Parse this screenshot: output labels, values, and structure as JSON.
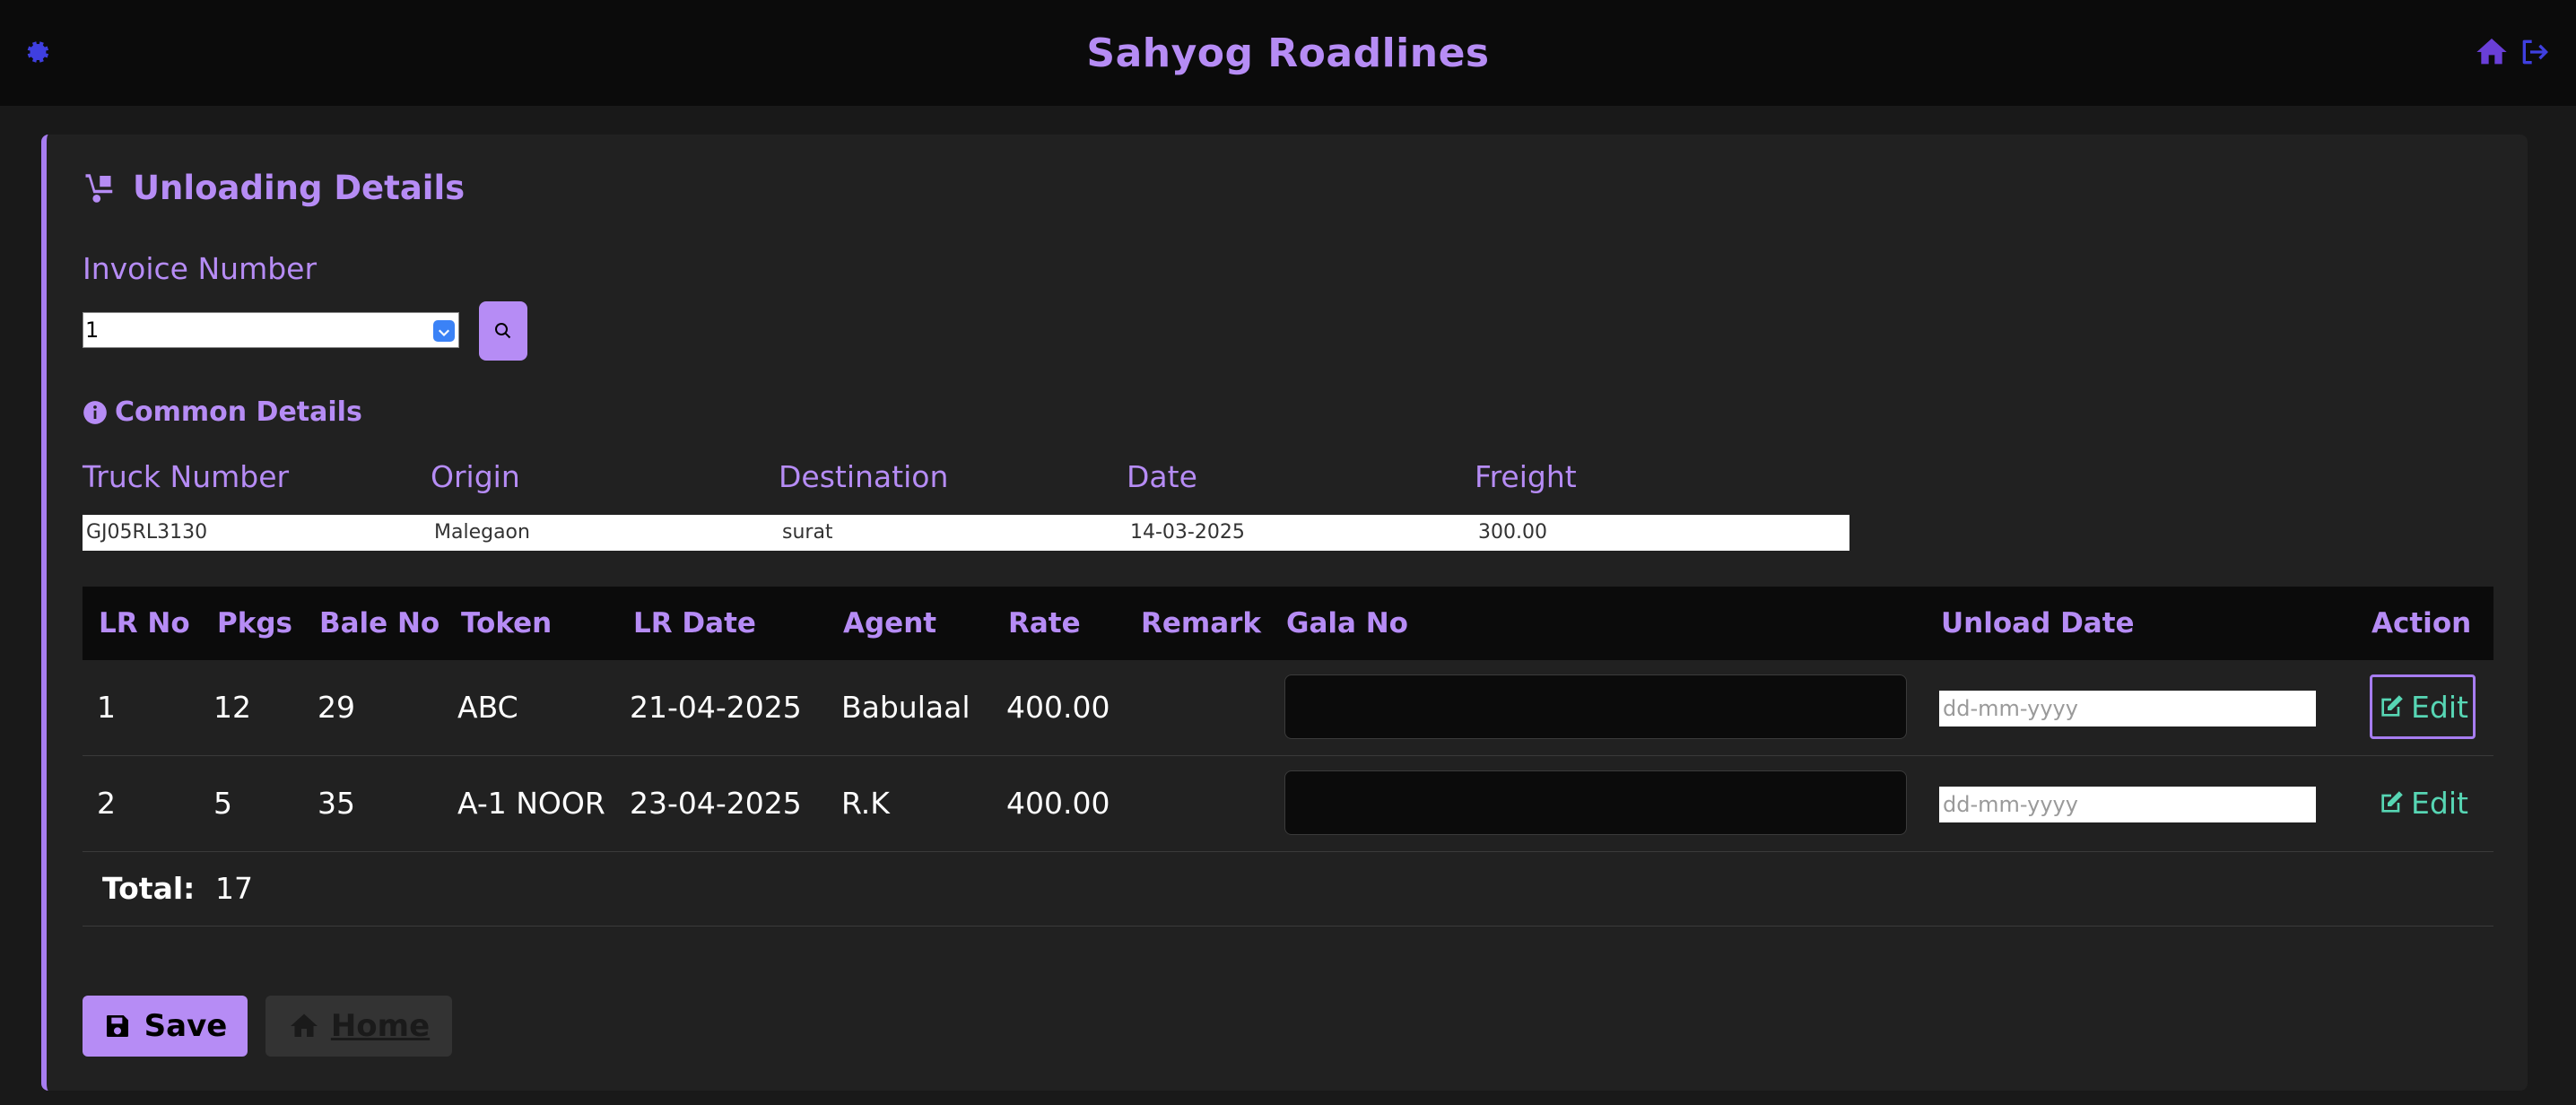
{
  "app": {
    "title": "Sahyog Roadlines",
    "accent": "#b68cf5",
    "icons": {
      "left": "gear-icon",
      "right": [
        "home-icon",
        "logout-icon"
      ]
    }
  },
  "card": {
    "title": "Unloading Details",
    "title_icon": "dolly-icon"
  },
  "invoice": {
    "label": "Invoice Number",
    "selected": "1",
    "search_icon": "search-icon"
  },
  "common": {
    "title": "Common Details",
    "headers": {
      "truck": "Truck Number",
      "origin": "Origin",
      "destination": "Destination",
      "date": "Date",
      "freight": "Freight"
    },
    "values": {
      "truck": "GJ05RL3130",
      "origin": "Malegaon",
      "destination": "surat",
      "date": "14-03-2025",
      "freight": "300.00"
    }
  },
  "table": {
    "headers": {
      "lr_no": "LR No",
      "pkgs": "Pkgs",
      "bale_no": "Bale No",
      "token": "Token",
      "lr_date": "LR Date",
      "agent": "Agent",
      "rate": "Rate",
      "remark": "Remark",
      "gala_no": "Gala No",
      "unload_date": "Unload Date",
      "action": "Action"
    },
    "rows": [
      {
        "lr_no": "1",
        "pkgs": "12",
        "bale_no": "29",
        "token": "ABC",
        "lr_date": "21-04-2025",
        "agent": "Babulaal",
        "rate": "400.00",
        "remark": "",
        "gala_no": "",
        "unload_placeholder": "dd-mm-yyyy",
        "action": "Edit"
      },
      {
        "lr_no": "2",
        "pkgs": "5",
        "bale_no": "35",
        "token": "A-1 NOOR",
        "lr_date": "23-04-2025",
        "agent": "R.K",
        "rate": "400.00",
        "remark": "",
        "gala_no": "",
        "unload_placeholder": "dd-mm-yyyy",
        "action": "Edit"
      }
    ],
    "total_label": "Total:",
    "total_value": "17"
  },
  "buttons": {
    "save": "Save",
    "home": "Home"
  }
}
